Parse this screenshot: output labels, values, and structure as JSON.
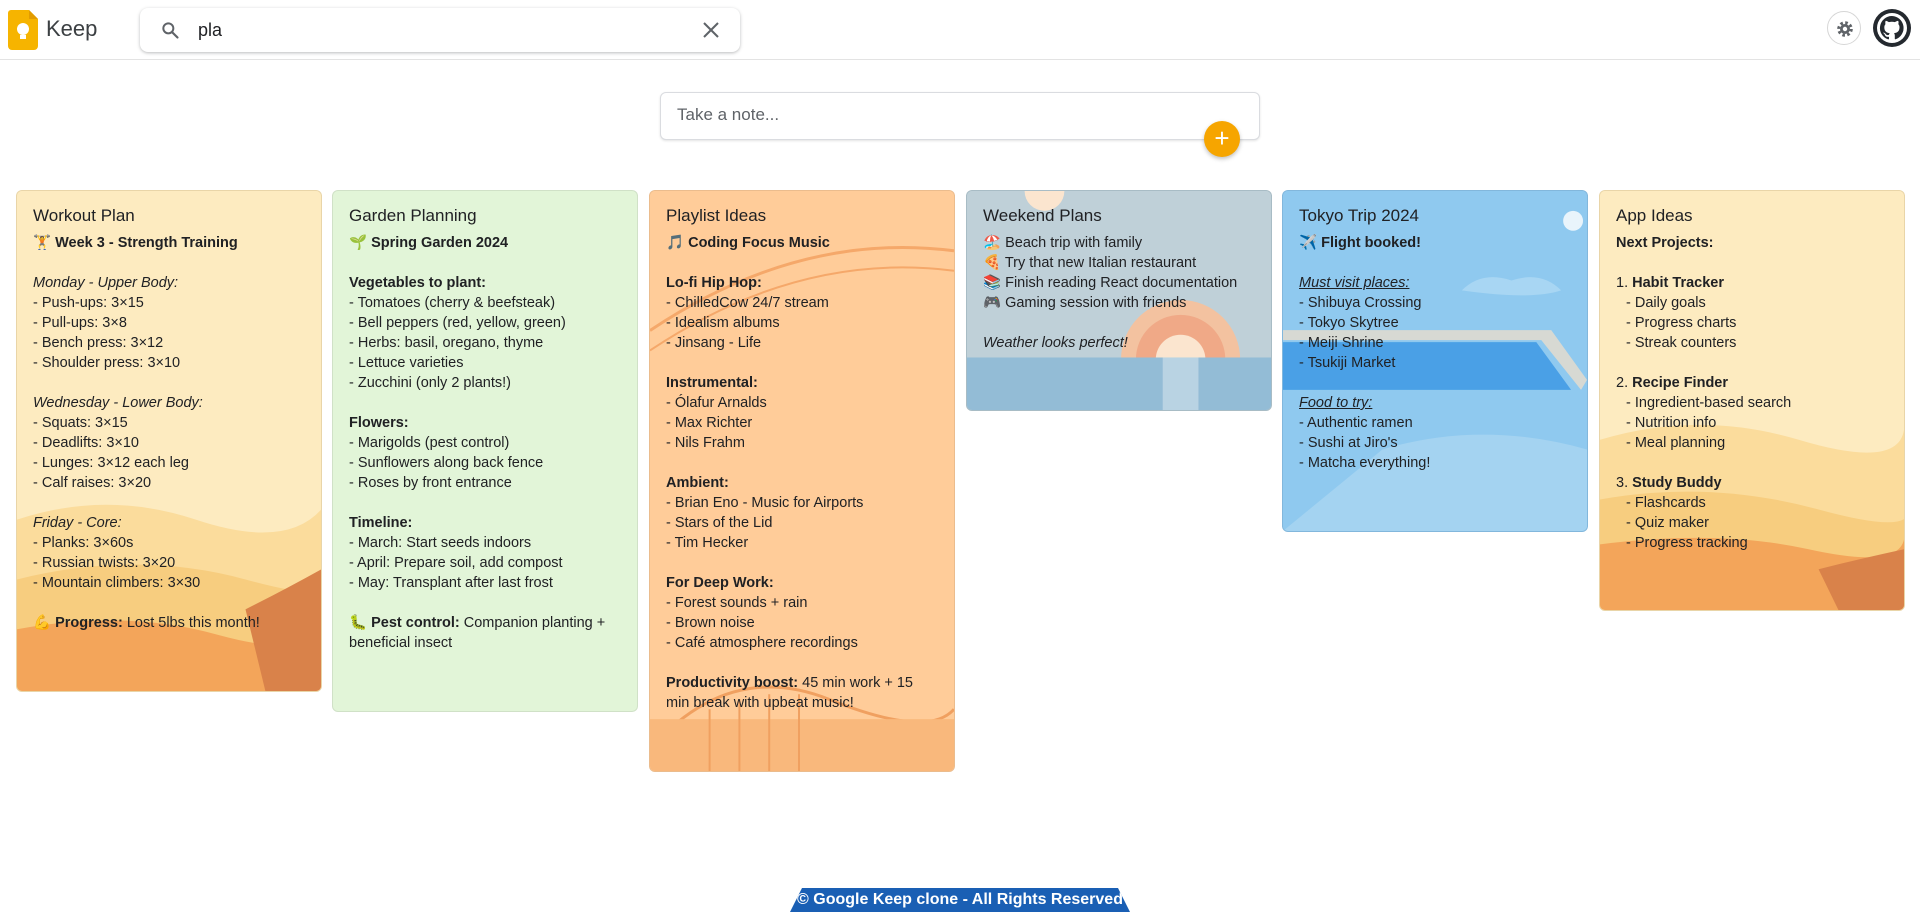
{
  "app": {
    "title": "Keep"
  },
  "search": {
    "value": "pla",
    "placeholder": "Search"
  },
  "take_note": {
    "placeholder": "Take a note..."
  },
  "add_label": "+",
  "notes": [
    {
      "title": "Workout Plan",
      "lines": [
        "🏋️ ",
        "Week 3 - Strength Training",
        "Monday - Upper Body:",
        "- Push-ups: 3×15",
        "- Pull-ups: 3×8",
        "- Bench press: 3×12",
        "- Shoulder press: 3×10",
        "Wednesday - Lower Body:",
        "- Squats: 3×15",
        "- Deadlifts: 3×10",
        "- Lunges: 3×12 each leg",
        "- Calf raises: 3×20",
        "Friday - Core:",
        "- Planks: 3×60s",
        "- Russian twists: 3×20",
        "- Mountain climbers: 3×30",
        "💪 ",
        "Progress:",
        " Lost 5lbs this month!"
      ]
    },
    {
      "title": "Garden Planning",
      "lines": [
        "🌱 ",
        "Spring Garden 2024",
        "Vegetables to plant:",
        "- Tomatoes (cherry & beefsteak)",
        "- Bell peppers (red, yellow, green)",
        "- Herbs: basil, oregano, thyme",
        "- Lettuce varieties",
        "- Zucchini (only 2 plants!)",
        "Flowers:",
        "- Marigolds (pest control)",
        "- Sunflowers along back fence",
        "- Roses by front entrance",
        "Timeline:",
        "- March: Start seeds indoors",
        "- April: Prepare soil, add compost",
        "- May: Transplant after last frost",
        "🐛 ",
        "Pest control:",
        " Companion planting + beneficial insect"
      ]
    },
    {
      "title": "Playlist Ideas",
      "lines": [
        "🎵 ",
        "Coding Focus Music",
        "Lo-fi Hip Hop:",
        "- ChilledCow 24/7 stream",
        "- Idealism albums",
        "- Jinsang - Life",
        "Instrumental:",
        "- Ólafur Arnalds",
        "- Max Richter",
        "- Nils Frahm",
        "Ambient:",
        "- Brian Eno - Music for Airports",
        "- Stars of the Lid",
        "- Tim Hecker",
        "For Deep Work:",
        "- Forest sounds + rain",
        "- Brown noise",
        "- Café atmosphere recordings",
        "Productivity boost:",
        " 45 min work + 15 min break with upbeat music!"
      ]
    },
    {
      "title": "Weekend Plans",
      "lines": [
        "🏖️ ",
        "Beach trip with family",
        "🍕 ",
        "Try that new Italian restaurant",
        "📚 ",
        "Finish reading React documentation",
        "🎮 ",
        "Gaming session with friends",
        "Weather looks perfect!"
      ]
    },
    {
      "title": "Tokyo Trip 2024",
      "lines": [
        "✈️ ",
        "Flight booked!",
        "Must visit places:",
        "- Shibuya Crossing",
        "- Tokyo Skytree",
        "- Meiji Shrine",
        "- Tsukiji Market",
        "Food to try:",
        "- Authentic ramen",
        "- Sushi at Jiro's",
        "- Matcha everything!"
      ]
    },
    {
      "title": "App Ideas",
      "lines": [
        "Next Projects:",
        "1. ",
        "Habit Tracker",
        "- Daily goals",
        "- Progress charts",
        "- Streak counters",
        "2. ",
        "Recipe Finder",
        "- Ingredient-based search",
        "- Nutrition info",
        "- Meal planning",
        "3. ",
        "Study Buddy",
        "- Flashcards",
        "- Quiz maker",
        "- Progress tracking"
      ]
    }
  ],
  "footer": {
    "text": "© Google Keep clone - All Rights Reserved"
  }
}
